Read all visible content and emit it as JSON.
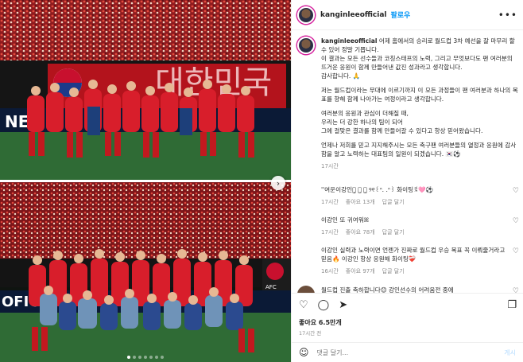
{
  "post": {
    "handle": "kanginleeofficial",
    "follow_label": "팔로우",
    "more_icon": "more-horizontal-icon"
  },
  "caption": {
    "author": "kanginleeofficial",
    "paragraphs": [
      "어제 홈에서의 승리로 월드컵 3차 예선을 잘 마무리 할 수 있어 정말 기쁩니다.\n이 결과는 모든 선수들과 코칭스태프의 노력, 그리고 무엇보다도 팬 여러분의 뜨거운 응원이 함께 만들어낸 값진 성과라고 생각합니다.\n감사합니다. 🙏",
      "저는 월드컵이라는 무대에 이르기까지 이 모든 과정들이 팬 여러분과 하나의 목표를 향해 함께 나아가는 여정이라고 생각합니다.",
      "여러분의 응원과 관심이 더해질 때,\n우리는 더 강한 하나의 팀이 되어\n그에 걸맞은 결과를 함께 만들어갈 수 있다고 항상 믿어왔습니다.",
      "언제나 저희를 믿고 지지해주시는 모든 축구팬 여러분들의 열정과 응원에 감사함을 알고 노력하는 대표팀의 일원이 되겠습니다. 🇰🇷⚽"
    ],
    "time": "17시간"
  },
  "comments": [
    {
      "text": "''여운이강인ꪔ̤̥ ꪔ̤̮ ꪔ̤̫ ୨୧꒰ᐢ. .ᐢ꒱ 화이팅ꉂ🩷⚽",
      "time": "17시간",
      "likes": "좋아요 13개",
      "reply": "답글 달기"
    },
    {
      "text": "이강인 또 귀여워ꕤ",
      "time": "17시간",
      "likes": "좋아요 78개",
      "reply": "답글 달기"
    },
    {
      "text": "이강인 실력과 노력이면 언젠가 진짜로 월드컵 우승 목표 꼭 이뤄줄거라고 믿음🔥 이강인 항상 응원해 화이팅❤️‍🩹",
      "time": "16시간",
      "likes": "좋아요 97개",
      "reply": "답글 달기"
    },
    {
      "text": "월드컵 진출 축하합니다😊 강인선수의 어려움전 중에",
      "time": "",
      "likes": "",
      "reply": ""
    }
  ],
  "actions": {
    "like_icon": "heart-icon",
    "comment_icon": "comment-icon",
    "share_icon": "share-icon",
    "save_icon": "bookmark-icon",
    "likes_text": "좋아요 6.5만개",
    "posted_time": "17시간 전"
  },
  "add_comment": {
    "placeholder": "댓글 달기...",
    "post_label": "게시"
  },
  "colors": {
    "follow_blue": "#0095f6",
    "jersey_red": "#d81e2b",
    "pitch_green": "#2f6b35",
    "story_ring": "#d6249f"
  }
}
